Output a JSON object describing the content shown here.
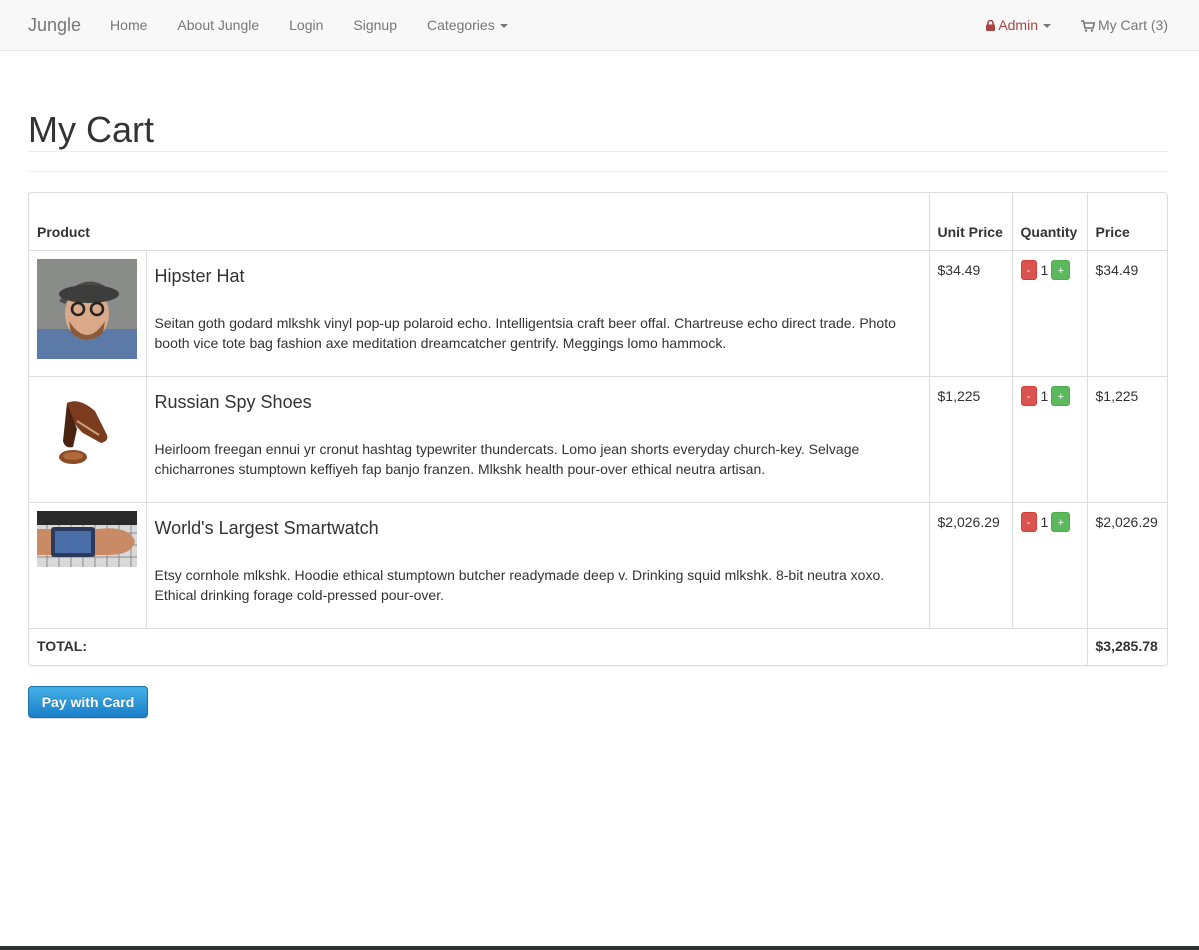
{
  "nav": {
    "brand": "Jungle",
    "links": [
      "Home",
      "About Jungle",
      "Login",
      "Signup",
      "Categories"
    ],
    "admin_label": "Admin",
    "cart_label": "My Cart (3)"
  },
  "page": {
    "title": "My Cart"
  },
  "table": {
    "headers": {
      "product": "Product",
      "unit_price": "Unit Price",
      "quantity": "Quantity",
      "price": "Price"
    },
    "items": [
      {
        "name": "Hipster Hat",
        "description": "Seitan goth godard mlkshk vinyl pop-up polaroid echo. Intelligentsia craft beer offal. Chartreuse echo direct trade. Photo booth vice tote bag fashion axe meditation dreamcatcher gentrify. Meggings lomo hammock.",
        "unit_price": "$34.49",
        "quantity": "1",
        "price": "$34.49",
        "image": "man-in-hat-photo"
      },
      {
        "name": "Russian Spy Shoes",
        "description": "Heirloom freegan ennui yr cronut hashtag typewriter thundercats. Lomo jean shorts everyday church-key. Selvage chicharrones stumptown keffiyeh fap banjo franzen. Mlkshk health pour-over ethical neutra artisan.",
        "unit_price": "$1,225",
        "quantity": "1",
        "price": "$1,225",
        "image": "shoe-photo"
      },
      {
        "name": "World's Largest Smartwatch",
        "description": "Etsy cornhole mlkshk. Hoodie ethical stumptown butcher readymade deep v. Drinking squid mlkshk. 8-bit neutra xoxo. Ethical drinking forage cold-pressed pour-over.",
        "unit_price": "$2,026.29",
        "quantity": "1",
        "price": "$2,026.29",
        "image": "smartwatch-photo"
      }
    ],
    "minus_label": "-",
    "plus_label": "+",
    "total_label": "TOTAL:",
    "total_value": "$3,285.78"
  },
  "pay_button": "Pay with Card",
  "colors": {
    "admin": "#a94442",
    "minus": "#d9534f",
    "plus": "#5cb85c",
    "pay": "#1a7fc8"
  }
}
